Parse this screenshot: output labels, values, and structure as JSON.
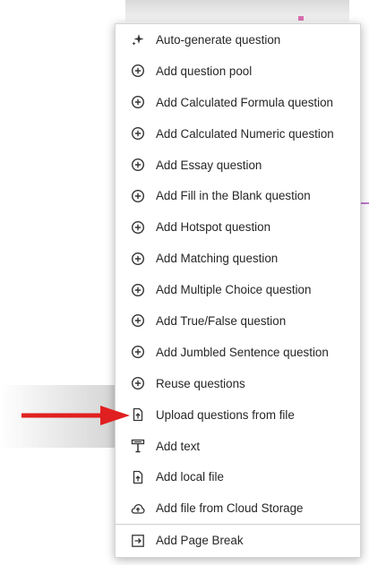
{
  "menu": {
    "items": [
      {
        "label": "Auto-generate question",
        "icon": "sparkle-icon"
      },
      {
        "label": "Add question pool",
        "icon": "plus-circle-icon"
      },
      {
        "label": "Add Calculated Formula question",
        "icon": "plus-circle-icon"
      },
      {
        "label": "Add Calculated Numeric question",
        "icon": "plus-circle-icon"
      },
      {
        "label": "Add Essay question",
        "icon": "plus-circle-icon"
      },
      {
        "label": "Add Fill in the Blank question",
        "icon": "plus-circle-icon"
      },
      {
        "label": "Add Hotspot question",
        "icon": "plus-circle-icon"
      },
      {
        "label": "Add Matching question",
        "icon": "plus-circle-icon"
      },
      {
        "label": "Add Multiple Choice question",
        "icon": "plus-circle-icon"
      },
      {
        "label": "Add True/False question",
        "icon": "plus-circle-icon"
      },
      {
        "label": "Add Jumbled Sentence question",
        "icon": "plus-circle-icon"
      },
      {
        "label": "Reuse questions",
        "icon": "plus-circle-icon"
      },
      {
        "label": "Upload questions from file",
        "icon": "file-upload-icon"
      },
      {
        "label": "Add text",
        "icon": "text-block-icon"
      },
      {
        "label": "Add local file",
        "icon": "file-upload-icon"
      },
      {
        "label": "Add file from Cloud Storage",
        "icon": "cloud-upload-icon"
      }
    ],
    "page_break": {
      "label": "Add Page Break",
      "icon": "page-break-icon"
    }
  },
  "annotation": {
    "arrow_color": "#e02020"
  }
}
